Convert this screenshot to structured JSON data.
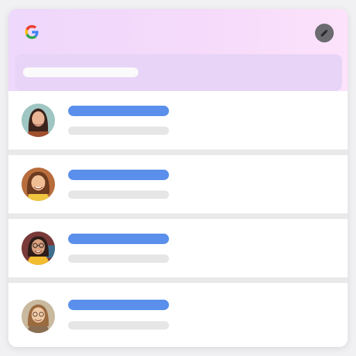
{
  "app": {
    "logo_icon": "google-g-icon",
    "edit_icon": "pencil-icon"
  },
  "header": {
    "search_bar": {
      "placeholder": "",
      "value": ""
    }
  },
  "contacts": [
    {
      "name": "",
      "detail": "",
      "avatar": "avatar-photo",
      "avatar_colors": {
        "bg": "#9fc6c2",
        "hair": "#3b241c",
        "skin": "#e9b595",
        "shirt": "#a0502f"
      }
    },
    {
      "name": "",
      "detail": "",
      "avatar": "avatar-photo",
      "avatar_colors": {
        "bg": "#b86d3c",
        "hair": "#6c3b20",
        "skin": "#f0be95",
        "shirt": "#f0c640"
      }
    },
    {
      "name": "",
      "detail": "",
      "avatar": "avatar-photo",
      "avatar_colors": {
        "bg": "#7a3a3a",
        "hair": "#2e1d18",
        "skin": "#d9a07e",
        "shirt": "#f3bd31"
      }
    },
    {
      "name": "",
      "detail": "",
      "avatar": "avatar-photo",
      "avatar_colors": {
        "bg": "#c9b99f",
        "hair": "#9b6a3f",
        "skin": "#f0c9a5",
        "shirt": "#8a6e52"
      }
    }
  ],
  "colors": {
    "accent_blue": "#5a8fec",
    "header_gradient_start": "#eed8fb",
    "header_gradient_end": "#fde2fb",
    "row_divider": "#e9e9e9",
    "skeleton_gray": "#e6e6e6"
  }
}
